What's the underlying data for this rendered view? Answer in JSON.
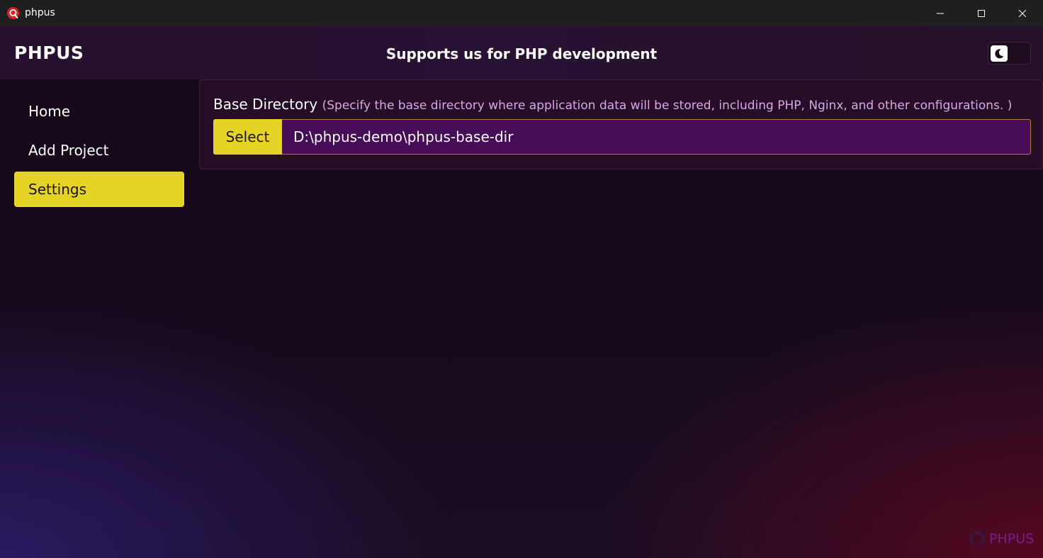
{
  "window": {
    "title": "phpus",
    "icon": "red-circle-q-icon"
  },
  "header": {
    "brand": "PHPUS",
    "title": "Supports us for PHP development",
    "theme_toggle_icon": "moon-icon"
  },
  "sidebar": {
    "items": [
      {
        "label": "Home",
        "active": false
      },
      {
        "label": "Add Project",
        "active": false
      },
      {
        "label": "Settings",
        "active": true
      }
    ]
  },
  "settings": {
    "base_directory": {
      "label": "Base Directory",
      "hint": "(Specify the base directory where application data will be stored, including PHP, Nginx, and other configurations. )",
      "button_label": "Select",
      "value": "D:\\phpus-demo\\phpus-base-dir"
    }
  },
  "footer": {
    "brand": "PHPUS",
    "icon": "github-icon"
  },
  "colors": {
    "accent": "#e5d426",
    "input_bg": "#470e58",
    "input_border": "#b27e2b",
    "footer_brand": "#7a1e8a"
  }
}
